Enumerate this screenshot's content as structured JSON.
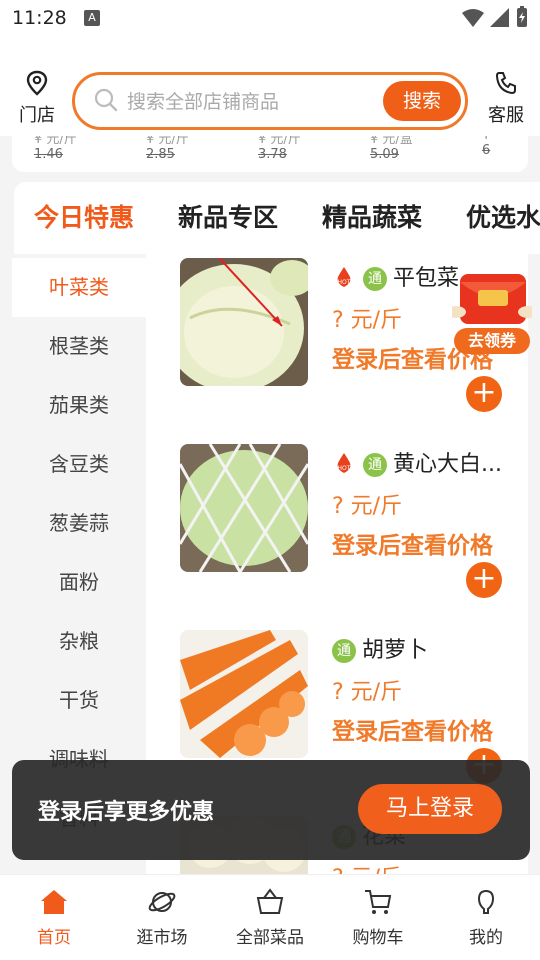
{
  "status_bar": {
    "time": "11:28",
    "notif": "A"
  },
  "header": {
    "store_label": "门店",
    "search_placeholder": "搜索全部店铺商品",
    "search_button": "搜索",
    "service_label": "客服"
  },
  "strip": {
    "items": [
      {
        "unit": "¥ 元/斤",
        "old": "1.46"
      },
      {
        "unit": "¥ 元/斤",
        "old": "2.85"
      },
      {
        "unit": "¥ 元/斤",
        "old": "3.78"
      },
      {
        "unit": "¥ 元/盒",
        "old": "5.09"
      },
      {
        "unit": "¥",
        "old": "6"
      }
    ]
  },
  "tabs": [
    "今日特惠",
    "新品专区",
    "精品蔬菜",
    "优选水"
  ],
  "sidebar": {
    "items": [
      "叶菜类",
      "根茎类",
      "茄果类",
      "含豆类",
      "葱姜蒜",
      "面粉",
      "杂粮",
      "干货",
      "调味料",
      "香料"
    ]
  },
  "products": [
    {
      "name": "平包菜",
      "price": "? 元/斤",
      "login_price": "登录后查看价格"
    },
    {
      "name": "黄心大白...",
      "price": "? 元/斤",
      "login_price": "登录后查看价格"
    },
    {
      "name": "胡萝卜",
      "price": "? 元/斤",
      "login_price": "登录后查看价格"
    },
    {
      "name": "花菜",
      "price": "? 元/斤",
      "login_price": ""
    }
  ],
  "tag_tong": "通",
  "coupon": {
    "label": "去领券"
  },
  "toast": {
    "message": "登录后享更多优惠",
    "button": "马上登录"
  },
  "nav": [
    "首页",
    "逛市场",
    "全部菜品",
    "购物车",
    "我的"
  ],
  "colors": {
    "accent": "#f05a1a",
    "brand_orange": "#f07a2a"
  }
}
